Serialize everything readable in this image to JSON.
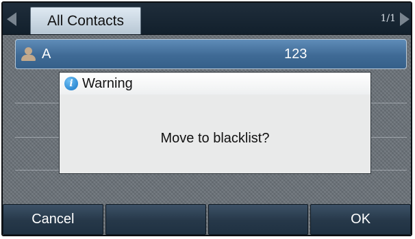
{
  "header": {
    "tab_label": "All Contacts",
    "page_indicator": "1/1"
  },
  "contact": {
    "name": "A",
    "number": "123"
  },
  "dialog": {
    "title": "Warning",
    "message": "Move to blacklist?",
    "icon": "info-icon"
  },
  "softkeys": [
    "Cancel",
    "",
    "",
    "OK"
  ],
  "colors": {
    "selection": "#4a77a3",
    "titlebar": "#1a2835",
    "softkey": "#2c3f51",
    "dialog_bg": "#e9eaea"
  }
}
